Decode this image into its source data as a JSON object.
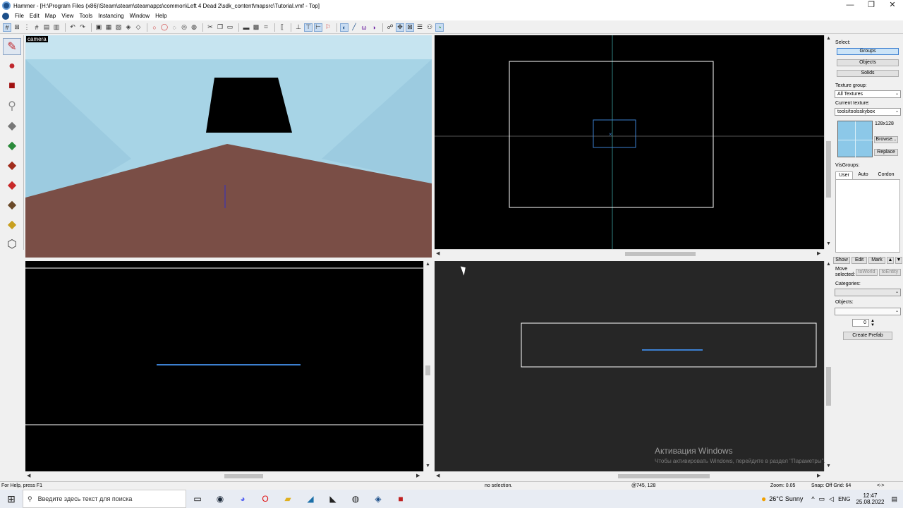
{
  "window": {
    "title": "Hammer - [H:\\Program Files (x86)\\Steam\\steam\\steamapps\\common\\Left 4 Dead 2\\sdk_content\\mapsrc\\Tutorial.vmf - Top]",
    "minimize": "—",
    "maximize": "❐",
    "close": "✕"
  },
  "menu": [
    "File",
    "Edit",
    "Map",
    "View",
    "Tools",
    "Instancing",
    "Window",
    "Help"
  ],
  "toolbar": {
    "icons": [
      "grid-toggle-icon",
      "grid-3d-icon",
      "grid-dots-icon",
      "grid-fine-icon",
      "load-window-state-icon",
      "save-window-state-icon",
      "undo-icon",
      "redo-icon",
      "carve-icon",
      "group-icon",
      "ungroup-icon",
      "to-world-icon",
      "to-entity-icon",
      "hide-icon",
      "unhide-icon",
      "texture-lock-icon",
      "cordon-icon",
      "snap-grid-icon",
      "toggle-3d-grid-icon",
      "larger-grid-icon",
      "smaller-grid-icon",
      "run-map-icon",
      "check-map-icon",
      "entity-report-icon",
      "texture-app-icon",
      "texture-lock-scale-icon",
      "ignore-groups-icon",
      "hide-items-icon",
      "show-helpers-icon",
      "instance-icon",
      "sprite-icon",
      "model-icon",
      "cubemap-icon",
      "ok-icon",
      "vis-icon"
    ]
  },
  "lefttools": [
    "selection-tool-icon",
    "magnify-tool-icon",
    "camera-tool-icon",
    "entity-tool-icon",
    "block-tool-icon",
    "texture-tool-icon",
    "apply-decal-icon",
    "overlay-tool-icon",
    "clipping-tool-icon",
    "vertex-tool-icon",
    "path-tool-icon"
  ],
  "viewports": {
    "camera_label": "camera"
  },
  "rightpanel": {
    "select_label": "Select:",
    "groups": "Groups",
    "objects": "Objects",
    "solids": "Solids",
    "texture_group_label": "Texture group:",
    "texture_group_value": "All Textures",
    "current_texture_label": "Current texture:",
    "current_texture_value": "tools/toolsskybox",
    "texture_size": "128x128",
    "browse": "Browse...",
    "replace": "Replace",
    "visgroups_label": "VisGroups:",
    "tabs": [
      "User",
      "Auto",
      "Cordon"
    ],
    "show": "Show",
    "edit": "Edit",
    "mark": "Mark",
    "move_selected_label": "Move selected:",
    "to_world": "toWorld",
    "to_entity": "toEntity",
    "categories_label": "Categories:",
    "objects_label": "Objects:",
    "count": "0",
    "create_prefab": "Create Prefab"
  },
  "status": {
    "help": "For Help, press F1",
    "selection": "no selection.",
    "coords": "@745, 128",
    "zoom": "Zoom: 0.05",
    "snap": "Snap: Off Grid: 64",
    "arrows": "<->"
  },
  "taskbar": {
    "search_placeholder": "Введите здесь текст для поиска",
    "weather": "26°C  Sunny",
    "time": "12:47",
    "date": "25.08.2022",
    "lang": "ENG"
  },
  "watermark": {
    "title": "Активация Windows",
    "subtitle": "Чтобы активировать Windows, перейдите в раздел \"Параметры\"."
  },
  "colors": {
    "sky": "#a7d4e6",
    "floor": "#7a4e46",
    "selection_box": "#ffffff",
    "brush_blue": "#3c7fd0"
  }
}
